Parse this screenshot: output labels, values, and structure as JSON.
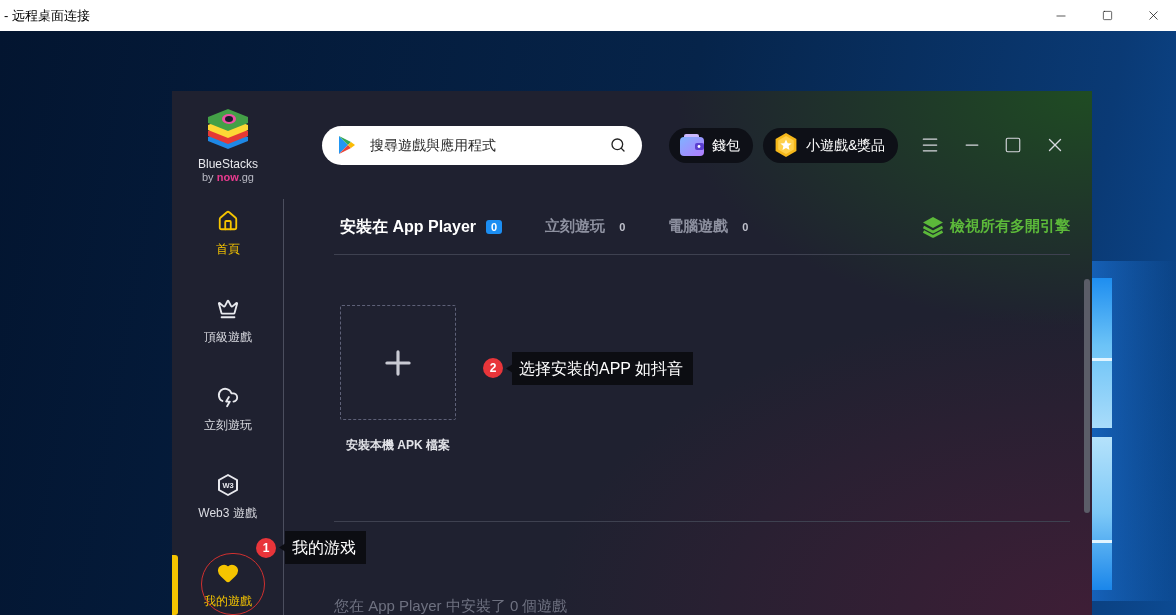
{
  "remote_window": {
    "title": "- 远程桌面连接"
  },
  "app": {
    "logo": {
      "name": "BlueStacks",
      "byline": "by **now**.gg"
    },
    "search": {
      "placeholder": "搜尋遊戲與應用程式"
    },
    "header_buttons": [
      {
        "kind": "wallet",
        "label": "錢包"
      },
      {
        "kind": "rewards",
        "label": "小遊戲&獎品"
      }
    ],
    "sidebar": {
      "items": [
        {
          "kind": "home",
          "label": "首頁",
          "selected": false,
          "highlighted": true,
          "circled": false
        },
        {
          "kind": "crown",
          "label": "頂級遊戲",
          "selected": false,
          "highlighted": false,
          "circled": false
        },
        {
          "kind": "cloud",
          "label": "立刻遊玩",
          "selected": false,
          "highlighted": false,
          "circled": false
        },
        {
          "kind": "web3",
          "icon_text": "W3",
          "label": "Web3 遊戲",
          "selected": false,
          "highlighted": false,
          "circled": false
        },
        {
          "kind": "heart",
          "label": "我的遊戲",
          "selected": true,
          "highlighted": true,
          "circled": true,
          "note": {
            "number": "1",
            "text": "我的游戏"
          }
        }
      ]
    },
    "tabs": [
      {
        "label": "安裝在 App Player",
        "count": "0",
        "selected": true
      },
      {
        "label": "立刻遊玩",
        "count": "0",
        "selected": false
      },
      {
        "label": "電腦遊戲",
        "count": "0",
        "selected": false
      }
    ],
    "multi_instance_link": {
      "label": "檢視所有多開引擎"
    },
    "install_tile": {
      "label": "安裝本機 APK 檔案",
      "note": {
        "number": "2",
        "text": "选择安装的APP 如抖音"
      }
    },
    "installed_summary": "您在 App Player 中安裝了 0 個遊戲"
  }
}
